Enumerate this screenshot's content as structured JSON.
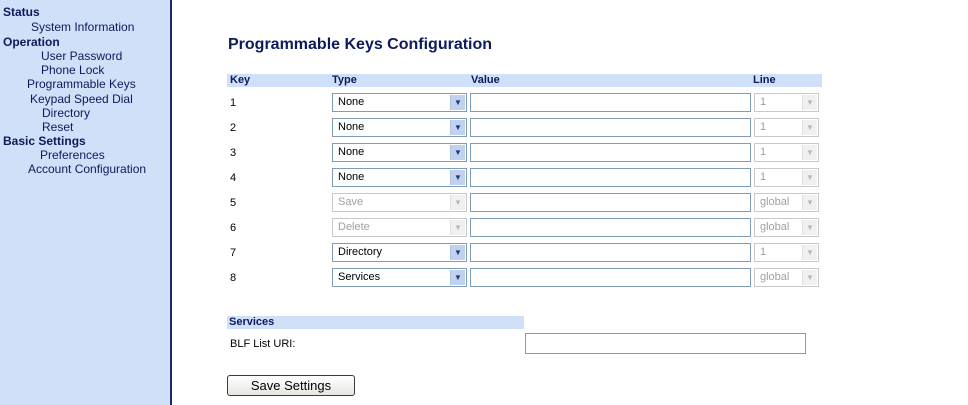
{
  "sidebar": {
    "groups": [
      {
        "label": "Status",
        "items": [
          "System Information"
        ]
      },
      {
        "label": "Operation",
        "items": [
          "User Password",
          "Phone Lock",
          "Programmable Keys",
          "Keypad Speed Dial",
          "Directory",
          "Reset"
        ]
      },
      {
        "label": "Basic Settings",
        "items": [
          "Preferences",
          "Account Configuration"
        ]
      }
    ]
  },
  "main": {
    "title": "Programmable Keys Configuration",
    "headers": {
      "key": "Key",
      "type": "Type",
      "value": "Value",
      "line": "Line"
    },
    "rows": [
      {
        "key": "1",
        "type": "None",
        "type_disabled": false,
        "value": "",
        "line": "1",
        "line_disabled": true
      },
      {
        "key": "2",
        "type": "None",
        "type_disabled": false,
        "value": "",
        "line": "1",
        "line_disabled": true
      },
      {
        "key": "3",
        "type": "None",
        "type_disabled": false,
        "value": "",
        "line": "1",
        "line_disabled": true
      },
      {
        "key": "4",
        "type": "None",
        "type_disabled": false,
        "value": "",
        "line": "1",
        "line_disabled": true
      },
      {
        "key": "5",
        "type": "Save",
        "type_disabled": true,
        "value": "",
        "line": "global",
        "line_disabled": true
      },
      {
        "key": "6",
        "type": "Delete",
        "type_disabled": true,
        "value": "",
        "line": "global",
        "line_disabled": true
      },
      {
        "key": "7",
        "type": "Directory",
        "type_disabled": false,
        "value": "",
        "line": "1",
        "line_disabled": true
      },
      {
        "key": "8",
        "type": "Services",
        "type_disabled": false,
        "value": "",
        "line": "global",
        "line_disabled": true
      }
    ],
    "services": {
      "title": "Services",
      "blf_label": "BLF List URI:",
      "blf_value": ""
    },
    "save_label": "Save Settings"
  },
  "icons": {
    "dropdown_arrow": "chevron-down-icon"
  },
  "colors": {
    "header_bg": "#cfe0f8",
    "heading_text": "#0d1a5c",
    "sidebar_border": "#1a2a6c"
  }
}
